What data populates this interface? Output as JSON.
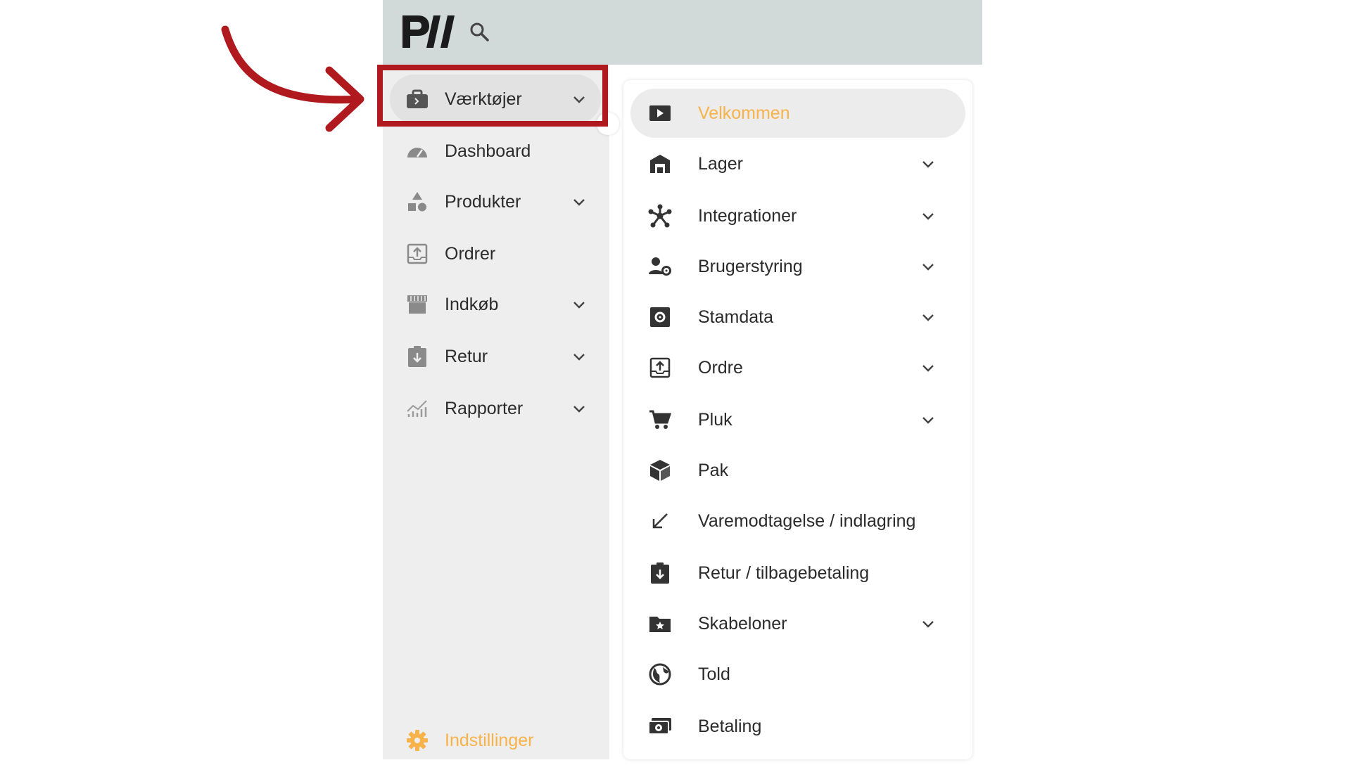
{
  "logo": {
    "text": "P//"
  },
  "sidebar": {
    "items": [
      {
        "label": "Værktøjer",
        "icon": "toolbox-icon",
        "chevron": true,
        "active": true
      },
      {
        "label": "Dashboard",
        "icon": "gauge-icon",
        "chevron": false
      },
      {
        "label": "Produkter",
        "icon": "shapes-icon",
        "chevron": true
      },
      {
        "label": "Ordrer",
        "icon": "upload-box-icon",
        "chevron": false
      },
      {
        "label": "Indkøb",
        "icon": "storefront-icon",
        "chevron": true
      },
      {
        "label": "Retur",
        "icon": "return-clipboard-icon",
        "chevron": true
      },
      {
        "label": "Rapporter",
        "icon": "chart-icon",
        "chevron": true
      }
    ],
    "settings": {
      "label": "Indstillinger",
      "icon": "gear-icon"
    }
  },
  "submenu": {
    "items": [
      {
        "label": "Velkommen",
        "icon": "play-icon",
        "chevron": false,
        "active": true
      },
      {
        "label": "Lager",
        "icon": "warehouse-icon",
        "chevron": true
      },
      {
        "label": "Integrationer",
        "icon": "hub-icon",
        "chevron": true
      },
      {
        "label": "Brugerstyring",
        "icon": "user-settings-icon",
        "chevron": true
      },
      {
        "label": "Stamdata",
        "icon": "settings-box-icon",
        "chevron": true
      },
      {
        "label": "Ordre",
        "icon": "upload-box-icon",
        "chevron": true
      },
      {
        "label": "Pluk",
        "icon": "cart-icon",
        "chevron": true
      },
      {
        "label": "Pak",
        "icon": "package-icon",
        "chevron": false
      },
      {
        "label": "Varemodtagelse / indlagring",
        "icon": "arrow-down-left-icon",
        "chevron": false
      },
      {
        "label": "Retur / tilbagebetaling",
        "icon": "return-clipboard-icon",
        "chevron": false
      },
      {
        "label": "Skabeloner",
        "icon": "folder-star-icon",
        "chevron": true
      },
      {
        "label": "Told",
        "icon": "globe-icon",
        "chevron": false
      },
      {
        "label": "Betaling",
        "icon": "money-icon",
        "chevron": false
      }
    ]
  },
  "colors": {
    "accent": "#f7b24a",
    "annotation": "#b0191e",
    "topbar": "#d2d9d9",
    "sidebar": "#eeeeee"
  }
}
